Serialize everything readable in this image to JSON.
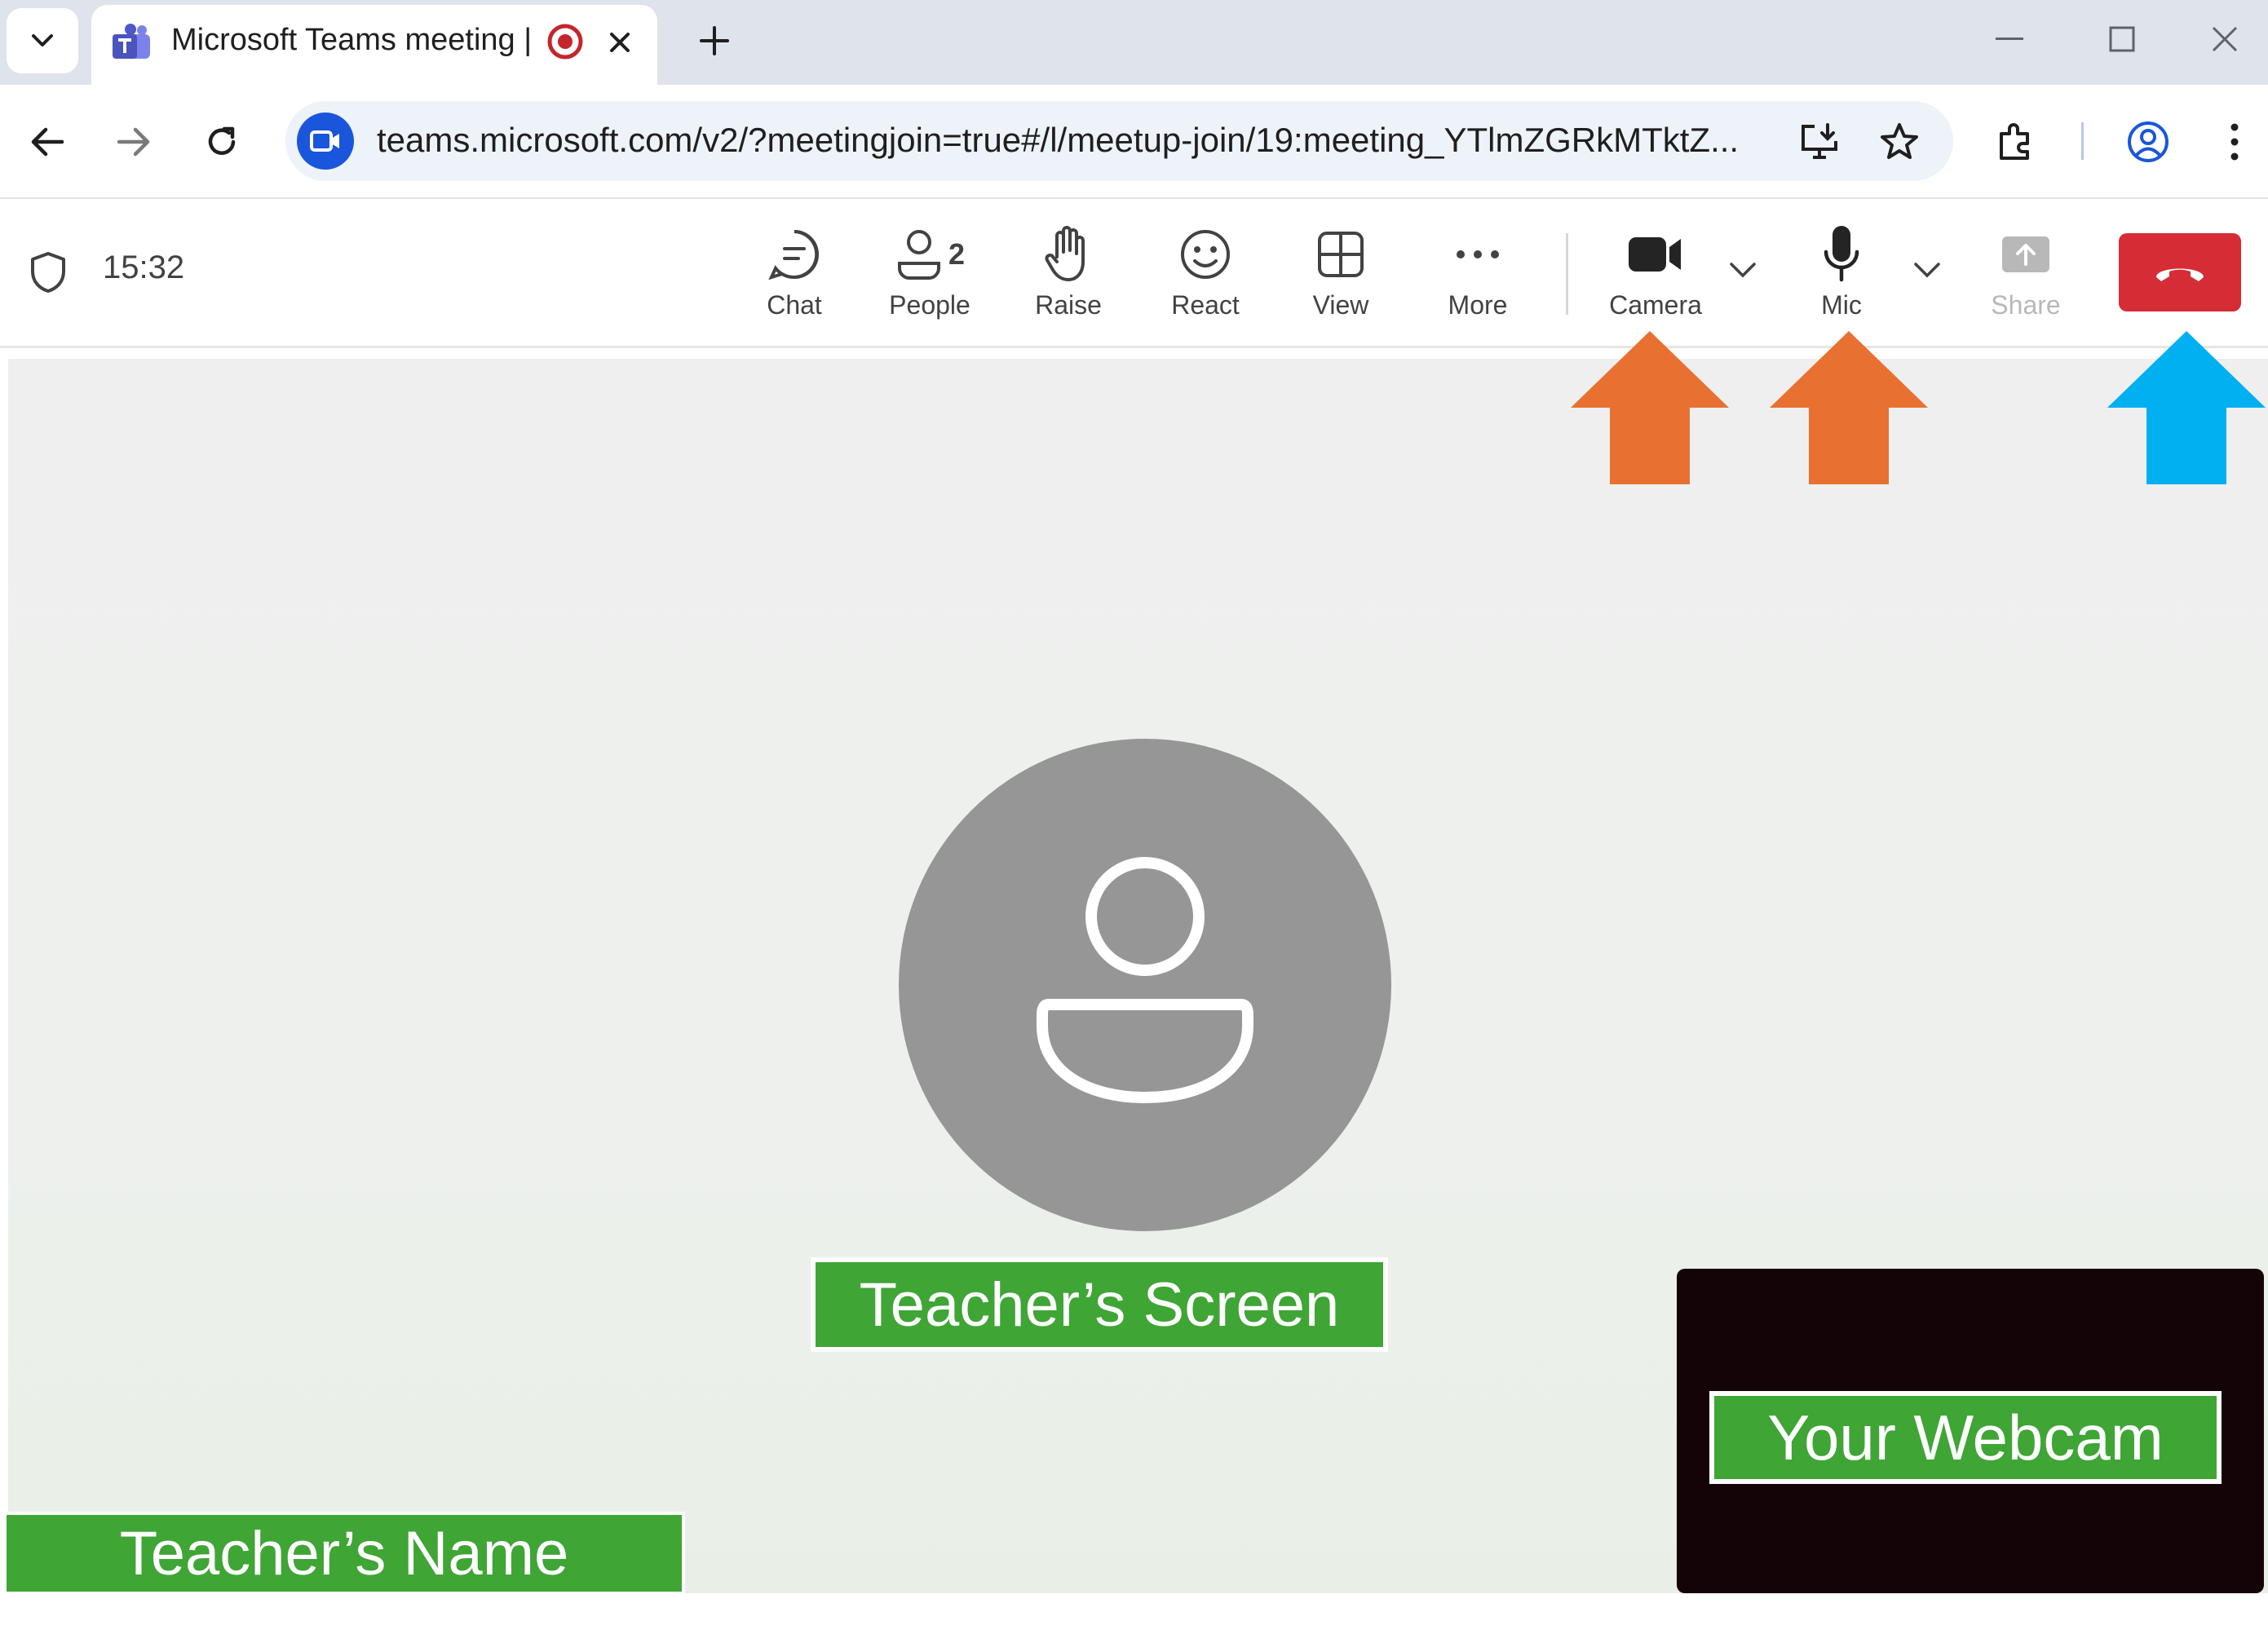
{
  "browser": {
    "tab_title": "Microsoft Teams meeting | Microsoft Teams",
    "url": "teams.microsoft.com/v2/?meetingjoin=true#/l/meetup-join/19:meeting_YTlmZGRkMTktZ..."
  },
  "toolbar": {
    "time": "15:32",
    "people_count": "2",
    "buttons": {
      "chat": "Chat",
      "people": "People",
      "raise": "Raise",
      "react": "React",
      "view": "View",
      "more": "More",
      "camera": "Camera",
      "mic": "Mic",
      "share": "Share"
    }
  },
  "annotations": {
    "teacher_screen": "Teacher’s Screen",
    "your_webcam": "Your Webcam",
    "teacher_name": "Teacher’s Name"
  },
  "colors": {
    "arrow_orange": "#e87132",
    "arrow_blue": "#00b0f0",
    "label_green": "#3fa535",
    "leave_red": "#d62c35"
  },
  "icons": [
    "chevron-down-icon",
    "teams-logo-icon",
    "recording-icon",
    "close-icon",
    "plus-icon",
    "minimize-icon",
    "maximize-icon",
    "back-icon",
    "forward-icon",
    "reload-icon",
    "video-icon",
    "install-icon",
    "star-icon",
    "extensions-icon",
    "profile-icon",
    "kebab-icon",
    "shield-icon",
    "chat-icon",
    "people-icon",
    "hand-icon",
    "smiley-icon",
    "view-grid-icon",
    "more-dots-icon",
    "camera-icon",
    "mic-icon",
    "share-icon",
    "hangup-icon",
    "person-icon"
  ]
}
